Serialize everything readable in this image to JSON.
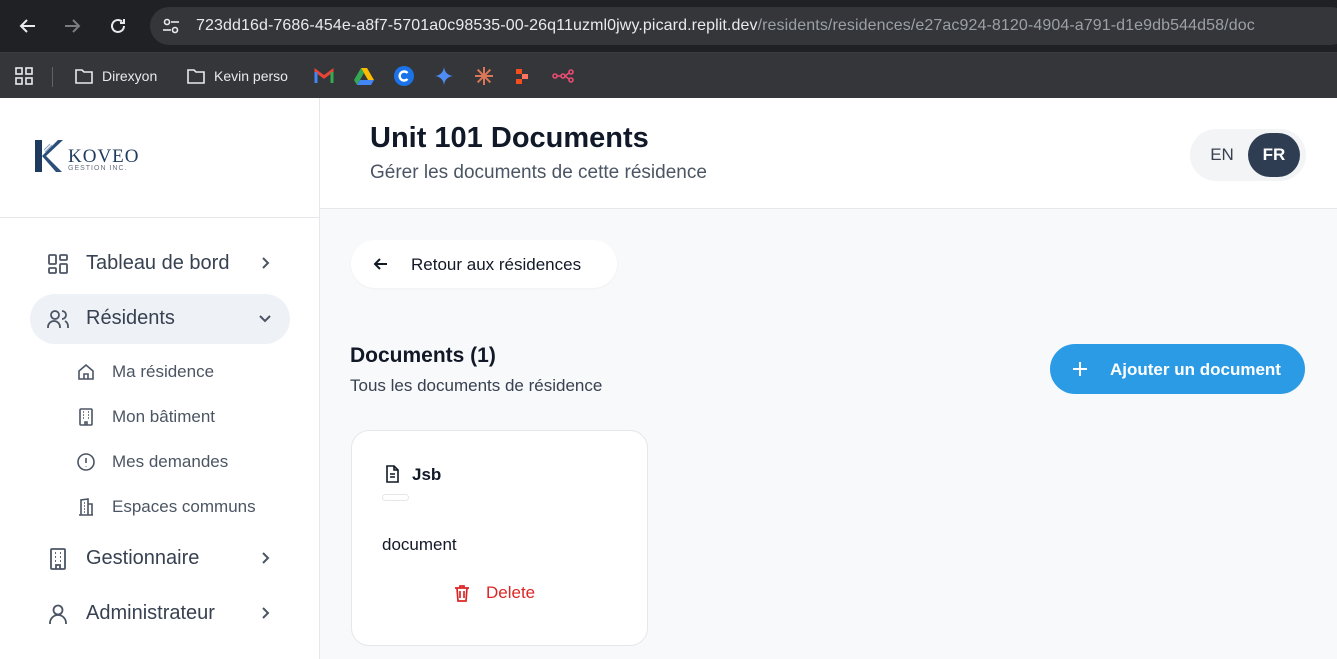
{
  "browser": {
    "url_host": "723dd16d-7686-454e-a8f7-5701a0c98535-00-26q11uzml0jwy.picard.replit.dev",
    "url_path": "/residents/residences/e27ac924-8120-4904-a791-d1e9db544d58/doc",
    "bookmarks": [
      {
        "label": "Direxyon",
        "icon": "folder-icon"
      },
      {
        "label": "Kevin perso",
        "icon": "folder-icon"
      }
    ],
    "bookmark_icons": [
      "gmail-icon",
      "google-drive-icon",
      "c-app-icon",
      "gemini-icon",
      "claude-icon",
      "figma-icon",
      "n8n-icon"
    ]
  },
  "logo": {
    "name": "KOVEO",
    "sub": "GESTION INC."
  },
  "sidebar": {
    "items": [
      {
        "label": "Tableau de bord",
        "icon": "dashboard-icon"
      },
      {
        "label": "Résidents",
        "icon": "users-icon"
      },
      {
        "label": "Gestionnaire",
        "icon": "building-icon"
      },
      {
        "label": "Administrateur",
        "icon": "user-icon"
      }
    ],
    "sub_items": [
      {
        "label": "Ma résidence",
        "icon": "home-icon"
      },
      {
        "label": "Mon bâtiment",
        "icon": "building-icon"
      },
      {
        "label": "Mes demandes",
        "icon": "alert-circle-icon"
      },
      {
        "label": "Espaces communs",
        "icon": "building-2-icon"
      }
    ]
  },
  "header": {
    "title": "Unit 101 Documents",
    "subtitle": "Gérer les documents de cette résidence",
    "lang_en": "EN",
    "lang_fr": "FR",
    "active_lang": "FR"
  },
  "main": {
    "back_label": "Retour aux résidences",
    "docs_title": "Documents (1)",
    "docs_subtitle": "Tous les documents de résidence",
    "add_label": "Ajouter un document",
    "accent_color": "#2b9be6",
    "documents": [
      {
        "name": "Jsb",
        "type": "document",
        "delete_label": "Delete"
      }
    ]
  }
}
